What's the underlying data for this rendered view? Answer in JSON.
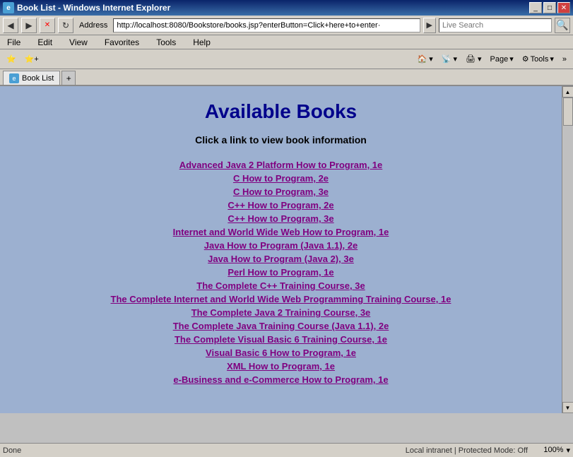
{
  "titlebar": {
    "title": "Book List - Windows Internet Explorer",
    "icon": "ie",
    "buttons": [
      "_",
      "□",
      "✕"
    ]
  },
  "addressbar": {
    "url": "http://localhost:8080/Bookstore/books.jsp?enterButton=Click+here+to+enter·",
    "search_placeholder": "Live Search"
  },
  "tab": {
    "label": "Book List"
  },
  "menubar": {
    "items": [
      "File",
      "Edit",
      "View",
      "Favorites",
      "Tools",
      "Help"
    ]
  },
  "toolbar": {
    "page_label": "Page",
    "tools_label": "Tools"
  },
  "content": {
    "title": "Available Books",
    "subtitle": "Click a link to view book information",
    "books": [
      "Advanced Java 2 Platform How to Program, 1e",
      "C How to Program, 2e",
      "C How to Program, 3e",
      "C++ How to Program, 2e",
      "C++ How to Program, 3e",
      "Internet and World Wide Web How to Program, 1e",
      "Java How to Program (Java 1.1), 2e",
      "Java How to Program (Java 2), 3e",
      "Perl How to Program, 1e",
      "The Complete C++ Training Course, 3e",
      "The Complete Internet and World Wide Web Programming Training Course, 1e",
      "The Complete Java 2 Training Course, 3e",
      "The Complete Java Training Course (Java 1.1), 2e",
      "The Complete Visual Basic 6 Training Course, 1e",
      "Visual Basic 6 How to Program, 1e",
      "XML How to Program, 1e",
      "e-Business and e-Commerce How to Program, 1e"
    ]
  }
}
